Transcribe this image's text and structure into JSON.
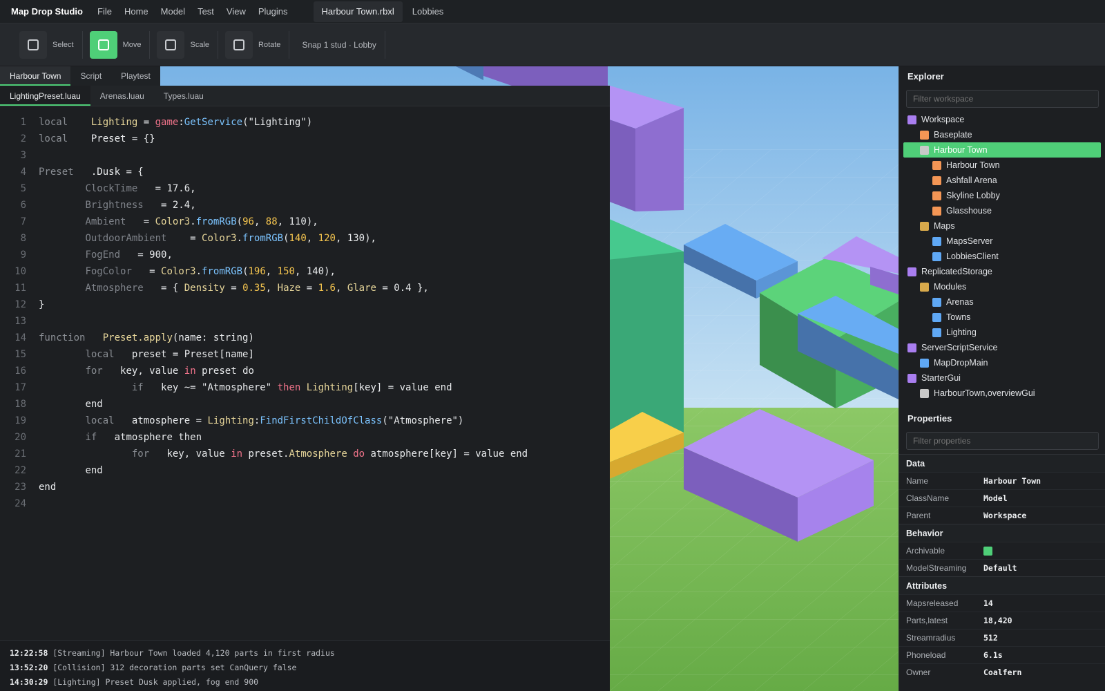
{
  "app": {
    "title": "Map Drop Studio"
  },
  "menu": [
    "File",
    "Home",
    "Model",
    "Test",
    "View",
    "Plugins"
  ],
  "doc_tabs": [
    "Harbour Town.rbxl",
    "Lobbies"
  ],
  "toolbar": {
    "tools": [
      {
        "label": "Select",
        "active": false
      },
      {
        "label": "Move",
        "active": true
      },
      {
        "label": "Scale",
        "active": false
      },
      {
        "label": "Rotate",
        "active": false
      }
    ],
    "snap": "Snap 1 stud · Lobby"
  },
  "view_tabs": [
    "Harbour Town",
    "Script",
    "Playtest"
  ],
  "file_tabs": [
    "LightingPreset.luau",
    "Arenas.luau",
    "Types.luau"
  ],
  "code": {
    "l1": [
      "local",
      "Lighting",
      "game",
      "GetService",
      "(\"Lighting\")"
    ],
    "l2": [
      "local",
      "Preset = {}"
    ],
    "l4": [
      "Preset",
      ".Dusk = {"
    ],
    "l5": [
      "ClockTime",
      " = ",
      "17.6",
      ","
    ],
    "l6": [
      "Brightness",
      " = ",
      "2.4",
      ","
    ],
    "l7": [
      "Ambient",
      "Color3",
      "fromRGB",
      "96",
      "88",
      "110"
    ],
    "l8": [
      "OutdoorAmbient",
      "Color3",
      "fromRGB",
      "140",
      "120",
      "130"
    ],
    "l9": [
      "FogEnd",
      " = ",
      "900",
      ","
    ],
    "l10": [
      "FogColor",
      "Color3",
      "fromRGB",
      "196",
      "150",
      "140"
    ],
    "l11": [
      "Atmosphere",
      "Density",
      "0.35",
      "Haze",
      "1.6",
      "Glare",
      "0.4"
    ],
    "l12": [
      "}"
    ],
    "l14": [
      "function",
      "Preset.apply",
      "(name: string)"
    ],
    "l15": [
      "local",
      "preset = Preset[name]"
    ],
    "l16": [
      "for",
      "key, value",
      "in",
      "preset do"
    ],
    "l17": [
      "if",
      "key ~= \"Atmosphere\"",
      "then",
      "Lighting",
      "[key] = value end"
    ],
    "l18": [
      "end"
    ],
    "l19": [
      "local",
      "atmosphere = ",
      "Lighting",
      "FindFirstChildOfClass",
      "(\"Atmosphere\")"
    ],
    "l20": [
      "if",
      "atmosphere then"
    ],
    "l21": [
      "for",
      "key, value",
      "in",
      "preset.",
      "Atmosphere",
      "do",
      "atmosphere[key] = value end"
    ],
    "l22": [
      "end"
    ],
    "l23": [
      "end"
    ]
  },
  "output": [
    {
      "time": "12:22:58",
      "text": "[Streaming] Harbour Town loaded 4,120 parts in first radius"
    },
    {
      "time": "13:52:20",
      "text": "[Collision] 312 decoration parts set CanQuery false"
    },
    {
      "time": "14:30:29",
      "text": "[Lighting] Preset Dusk applied, fog end 900"
    }
  ],
  "explorer": {
    "title": "Explorer",
    "filter_placeholder": "Filter workspace",
    "items": [
      {
        "label": "Workspace",
        "depth": 0,
        "color": "#a97ef0",
        "selected": false
      },
      {
        "label": "Baseplate",
        "depth": 1,
        "color": "#f49655",
        "selected": false
      },
      {
        "label": "Harbour Town",
        "depth": 1,
        "color": "#c8c8c8",
        "selected": true
      },
      {
        "label": "Harbour Town",
        "depth": 2,
        "color": "#f49655",
        "selected": false
      },
      {
        "label": "Ashfall Arena",
        "depth": 2,
        "color": "#f49655",
        "selected": false
      },
      {
        "label": "Skyline Lobby",
        "depth": 2,
        "color": "#f49655",
        "selected": false
      },
      {
        "label": "Glasshouse",
        "depth": 2,
        "color": "#f49655",
        "selected": false
      },
      {
        "label": "Maps",
        "depth": 1,
        "color": "#d8a94b",
        "selected": false
      },
      {
        "label": "MapsServer",
        "depth": 2,
        "color": "#5fa8f5",
        "selected": false
      },
      {
        "label": "LobbiesClient",
        "depth": 2,
        "color": "#5fa8f5",
        "selected": false
      },
      {
        "label": "ReplicatedStorage",
        "depth": 0,
        "color": "#a97ef0",
        "selected": false
      },
      {
        "label": "Modules",
        "depth": 1,
        "color": "#d8a94b",
        "selected": false
      },
      {
        "label": "Arenas",
        "depth": 2,
        "color": "#5fa8f5",
        "selected": false
      },
      {
        "label": "Towns",
        "depth": 2,
        "color": "#5fa8f5",
        "selected": false
      },
      {
        "label": "Lighting",
        "depth": 2,
        "color": "#5fa8f5",
        "selected": false
      },
      {
        "label": "ServerScriptService",
        "depth": 0,
        "color": "#a97ef0",
        "selected": false
      },
      {
        "label": "MapDropMain",
        "depth": 1,
        "color": "#5fa8f5",
        "selected": false
      },
      {
        "label": "StarterGui",
        "depth": 0,
        "color": "#a97ef0",
        "selected": false
      },
      {
        "label": "HarbourTown,overviewGui",
        "depth": 1,
        "color": "#c8c8c8",
        "selected": false
      }
    ]
  },
  "properties": {
    "title": "Properties",
    "filter_placeholder": "Filter properties",
    "sections": [
      {
        "name": "Data",
        "rows": [
          {
            "name": "Name",
            "value": "Harbour Town"
          },
          {
            "name": "ClassName",
            "value": "Model"
          },
          {
            "name": "Parent",
            "value": "Workspace"
          }
        ]
      },
      {
        "name": "Behavior",
        "rows": [
          {
            "name": "Archivable",
            "value": "",
            "checkbox": true
          },
          {
            "name": "ModelStreaming",
            "value": "Default"
          }
        ]
      },
      {
        "name": "Attributes",
        "rows": [
          {
            "name": "Mapsreleased",
            "value": "14"
          },
          {
            "name": "Parts,latest",
            "value": "18,420"
          },
          {
            "name": "Streamradius",
            "value": "512"
          },
          {
            "name": "Phoneload",
            "value": "6.1s"
          },
          {
            "name": "Owner",
            "value": "Coalfern"
          }
        ]
      }
    ]
  },
  "colors": {
    "accent": "#4fcf78",
    "sky": "#86b8e6",
    "ground": "#74b952"
  }
}
